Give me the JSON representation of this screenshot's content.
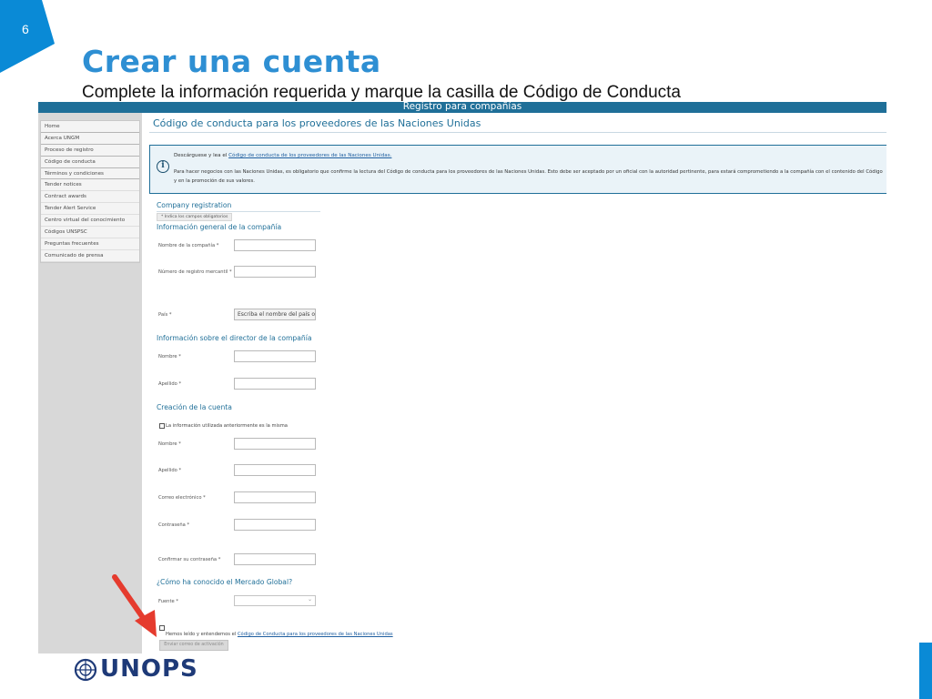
{
  "slide": {
    "number": "6",
    "title": "Crear una cuenta",
    "subtitle": "Complete la información requerida y marque la casilla de Código de Conducta",
    "logo_text": "UNOPS",
    "colors": {
      "accent": "#2e8fd3",
      "corner": "#0a8ad6",
      "header": "#1f6f98",
      "logo": "#1e3a78",
      "arrow": "#e53b2e"
    }
  },
  "screenshot": {
    "header_title": "Registro para compañías",
    "sidebar": {
      "items": [
        "Home",
        "Acerca UNGM",
        "Proceso de registro",
        "Código de conducta",
        "Términos y condiciones",
        "Tender notices",
        "Contract awards",
        "Tender Alert Service",
        "Centro virtual del conocimiento",
        "Códigos UNSPSC",
        "Preguntas frecuentes",
        "Comunicado de prensa"
      ]
    },
    "page_heading": "Código de conducta para los proveedores de las Naciones Unidas",
    "info": {
      "line1_prefix": "Descárguese y lea el",
      "line1_link": "Código de conducta de los proveedores de las Naciones Unidas.",
      "line2": "Para hacer negocios con las Naciones Unidas, es obligatorio que confirme la lectura del Código de conducta para los proveedores de las Naciones Unidas. Esto debe ser aceptado por un oficial con la autoridad pertinente, para estará comprometiendo a la compañía con el contenido del Código y en la promoción de sus valores."
    },
    "form": {
      "section_registration": "Company registration",
      "required_note": "* Indica los campos obligatorios",
      "section_general": "Información general de la compañía",
      "company_name_label": "Nombre de la compañía *",
      "commercial_register_label": "Número de registro mercantil *",
      "country_label": "País *",
      "country_placeholder": "Escriba el nombre del país o re",
      "section_director": "Información sobre el director de la compañía",
      "director_first_name_label": "Nombre *",
      "director_last_name_label": "Apellido *",
      "section_account": "Creación de la cuenta",
      "same_info_label": "La información utilizada anteriormente es la misma",
      "account_first_name_label": "Nombre *",
      "account_last_name_label": "Apellido *",
      "email_label": "Correo electrónico *",
      "password_label": "Contraseña *",
      "confirm_password_label": "Confirmar su contraseña *",
      "section_source": "¿Cómo ha conocido el Mercado Global?",
      "source_label": "Fuente *",
      "coc_prefix": "Hemos leído y entendemos el",
      "coc_link": "Código de Conducta para los proveedores de las Naciones Unidas",
      "submit_label": "Enviar correo de activación"
    }
  }
}
